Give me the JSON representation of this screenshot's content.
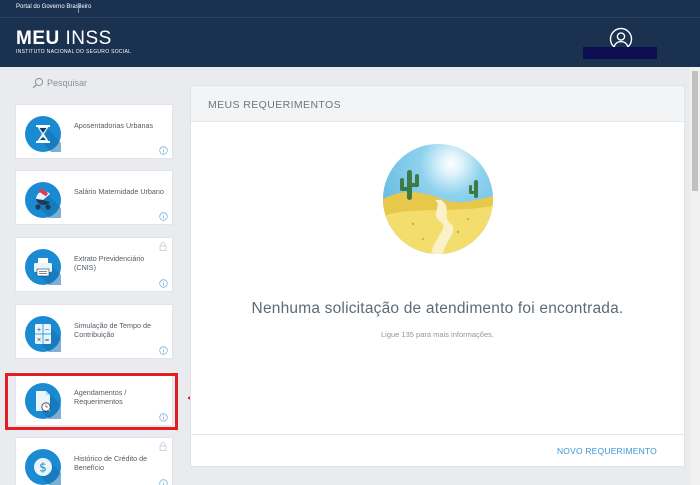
{
  "gov_bar": {
    "link": "Portal do Governo Brasileiro"
  },
  "header": {
    "title_bold": "MEU",
    "title_rest": " INSS",
    "subtitle": "INSTITUTO NACIONAL DO SEGURO SOCIAL",
    "user_icon": "user-circle-icon"
  },
  "search": {
    "label": "Pesquisar",
    "icon": "search-icon"
  },
  "services": [
    {
      "label": "Aposentadorias Urbanas",
      "icon": "hourglass-icon"
    },
    {
      "label": "Salário Maternidade Urbano",
      "icon": "stroller-icon"
    },
    {
      "label": "Extrato Previdenciário (CNIS)",
      "icon": "printer-icon"
    },
    {
      "label": "Simulação de Tempo de Contribuição",
      "icon": "calculator-icon"
    },
    {
      "label": "Agendamentos / Requerimentos",
      "icon": "document-clock-icon"
    },
    {
      "label": "Histórico de Crédito de Benefício",
      "icon": "money-icon"
    }
  ],
  "panel": {
    "title": "MEUS REQUERIMENTOS",
    "empty_message": "Nenhuma solicitação de atendimento foi encontrada.",
    "empty_hint": "Ligue 135 para mais informações.",
    "new_request": "NOVO REQUERIMENTO"
  },
  "colors": {
    "header_bg": "#1b3150",
    "accent": "#1a8ad3",
    "highlight": "#e01e24",
    "link": "#3a97d6"
  }
}
